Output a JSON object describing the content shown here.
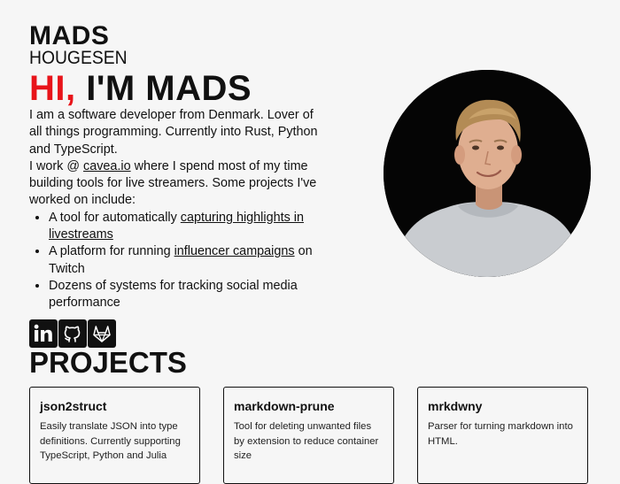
{
  "logo": {
    "line1": "MADS",
    "line2": "HOUGESEN"
  },
  "hero": {
    "greeting": "HI,",
    "name": "I'M MADS"
  },
  "intro": {
    "line1": "I am a software developer from Denmark. Lover of all things programming. Currently into Rust, Python and TypeScript.",
    "line2_prefix": "I work @ ",
    "line2_link": "cavea.io",
    "line2_suffix": " where I spend most of my time building tools for live streamers. Some projects I've worked on include:",
    "items": [
      {
        "prefix": "A tool for automatically ",
        "link": "capturing highlights in livestreams",
        "suffix": ""
      },
      {
        "prefix": "A platform for running ",
        "link": "influencer campaigns",
        "suffix": " on Twitch"
      },
      {
        "prefix": "Dozens of systems for tracking social media performance",
        "link": "",
        "suffix": ""
      }
    ]
  },
  "socials": [
    {
      "icon": "linkedin-icon"
    },
    {
      "icon": "github-icon"
    },
    {
      "icon": "gitlab-icon"
    }
  ],
  "projects": {
    "heading": "PROJECTS",
    "cards": [
      {
        "title": "json2struct",
        "description": "Easily translate JSON into type definitions. Currently supporting TypeScript, Python and Julia"
      },
      {
        "title": "markdown-prune",
        "description": "Tool for deleting unwanted files by extension to reduce container size"
      },
      {
        "title": "mrkdwny",
        "description": "Parser for turning markdown into HTML."
      }
    ]
  },
  "colors": {
    "accent": "#e8141a",
    "text": "#111111",
    "background": "#f6f6f6"
  }
}
